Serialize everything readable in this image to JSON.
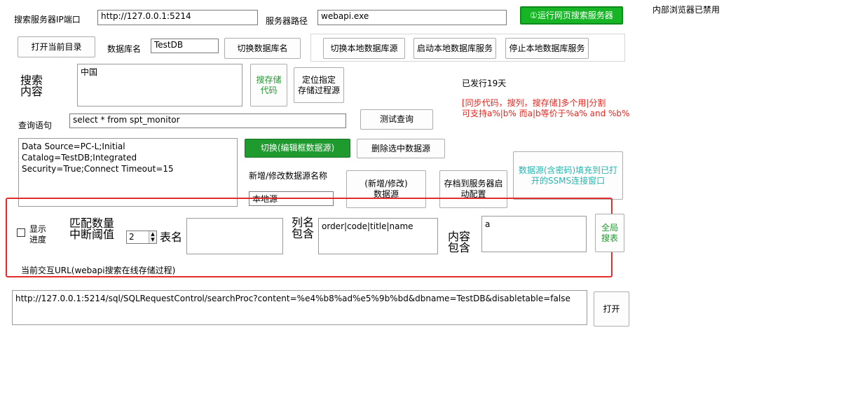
{
  "status_right": "内部浏览器已禁用",
  "server": {
    "ip_label": "搜索服务器IP端口",
    "ip_value": "http://127.0.0.1:5214",
    "path_label": "服务器路径",
    "path_value": "webapi.exe",
    "run_button": "①运行网页搜索服务器"
  },
  "row2": {
    "open_dir": "打开当前目录",
    "db_label": "数据库名",
    "db_value": "TestDB",
    "switch_db": "切换数据库名",
    "switch_local": "切换本地数据库源",
    "start_local": "启动本地数据库服务",
    "stop_local": "停止本地数据库服务"
  },
  "search": {
    "label_line1": "搜索",
    "label_line2": "内容",
    "content": "中国",
    "search_proc_line1": "搜存储",
    "search_proc_line2": "代码",
    "locate_line1": "定位指定",
    "locate_line2": "存储过程源"
  },
  "notes": {
    "released": "已发行19天",
    "hint_line1": "[同步代码，搜列，搜存储]多个用|分割",
    "hint_line2": "可支持a%|b% 而a|b等价于%a% and %b%"
  },
  "query": {
    "label": "查询语句",
    "value": "select * from spt_monitor",
    "test_button": "测试查询"
  },
  "datasource": {
    "conn": "Data Source=PC-L;Initial Catalog=TestDB;Integrated\nSecurity=True;Connect Timeout=15",
    "switch_button": "切换(编辑框数据源)",
    "delete_button": "删除选中数据源",
    "name_label": "新增/修改数据源名称",
    "name_value": "本地源",
    "add_line1": "(新增/修改)",
    "add_line2": "数据源",
    "archive_line1": "存档到服务器启",
    "archive_line2": "动配置",
    "fill_line1": "数据源(含密码)填充到已打",
    "fill_line2": "开的SSMS连接窗口"
  },
  "filter": {
    "show_progress_line1": "显示",
    "show_progress_line2": "进度",
    "threshold_line1": "匹配数量",
    "threshold_line2": "中断阈值",
    "threshold_value": "2",
    "table_label": "表名",
    "table_value": "",
    "col_line1": "列名",
    "col_line2": "包含",
    "col_value": "order|code|title|name",
    "content_line1": "内容",
    "content_line2": "包含",
    "content_value": "a",
    "global_line1": "全局",
    "global_line2": "搜表",
    "url_label": "当前交互URL(webapi搜索在线存储过程)"
  },
  "url": {
    "value": "http://127.0.0.1:5214/sql/SQLRequestControl/searchProc?content=%e4%b8%ad%e5%9b%bd&dbname=TestDB&disabletable=false",
    "open_button": "打开"
  }
}
